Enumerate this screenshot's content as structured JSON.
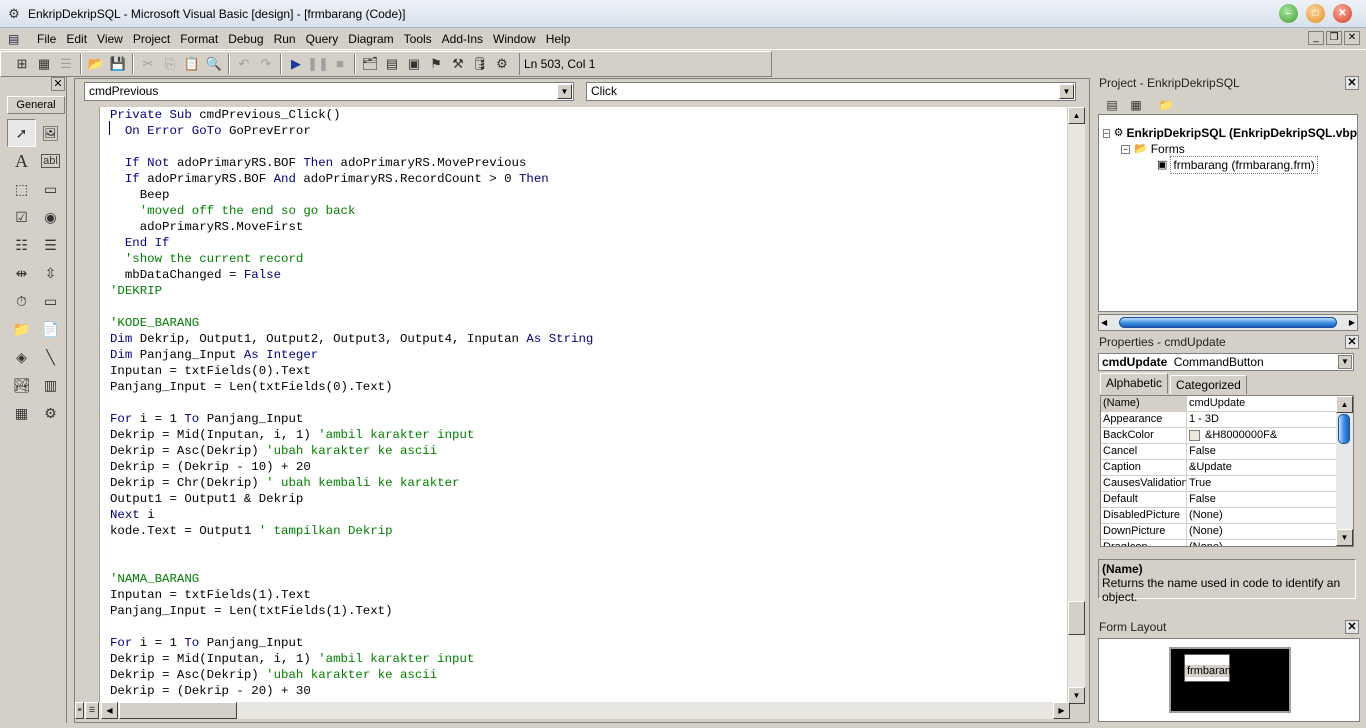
{
  "window": {
    "title": "EnkripDekripSQL - Microsoft Visual Basic [design] - [frmbarang (Code)]",
    "controls": {
      "minimize": "–",
      "maximize": "□",
      "close": "✕"
    }
  },
  "menu": [
    "File",
    "Edit",
    "View",
    "Project",
    "Format",
    "Debug",
    "Run",
    "Query",
    "Diagram",
    "Tools",
    "Add-Ins",
    "Window",
    "Help"
  ],
  "mdi_controls": {
    "minimize": "_",
    "restore": "❐",
    "close": "✕"
  },
  "toolbar": {
    "status": "Ln 503, Col 1",
    "icons": [
      "add-project-icon",
      "add-form-icon",
      "menu-editor-icon",
      "open-icon",
      "save-icon",
      "cut-icon",
      "copy-icon",
      "paste-icon",
      "find-icon",
      "undo-icon",
      "redo-icon",
      "run-icon",
      "break-icon",
      "stop-icon",
      "project-explorer-icon",
      "properties-window-icon",
      "form-layout-icon",
      "object-browser-icon",
      "toolbox-icon",
      "data-view-icon",
      "component-manager-icon"
    ]
  },
  "toolbox": {
    "tab": "General",
    "close": "✕",
    "tools": [
      "pointer",
      "picturebox",
      "label",
      "textbox",
      "frame",
      "commandbutton",
      "checkbox",
      "optionbutton",
      "combobox",
      "listbox",
      "hscrollbar",
      "vscrollbar",
      "timer",
      "drivelistbox",
      "dirlistbox",
      "filelistbox",
      "shape",
      "line",
      "image",
      "data",
      "ole",
      "adodc"
    ]
  },
  "code": {
    "object_combo": "cmdPrevious",
    "proc_combo": "Click",
    "lines": [
      [
        [
          "kw",
          "Private Sub "
        ],
        [
          "tx",
          "cmdPrevious_Click()"
        ]
      ],
      [
        [
          "tx",
          "  "
        ],
        [
          "kw",
          "On Error GoTo "
        ],
        [
          "tx",
          "GoPrevError"
        ]
      ],
      [],
      [
        [
          "tx",
          "  "
        ],
        [
          "kw",
          "If Not "
        ],
        [
          "tx",
          "adoPrimaryRS.BOF "
        ],
        [
          "kw",
          "Then "
        ],
        [
          "tx",
          "adoPrimaryRS.MovePrevious"
        ]
      ],
      [
        [
          "tx",
          "  "
        ],
        [
          "kw",
          "If "
        ],
        [
          "tx",
          "adoPrimaryRS.BOF "
        ],
        [
          "kw",
          "And "
        ],
        [
          "tx",
          "adoPrimaryRS.RecordCount > 0 "
        ],
        [
          "kw",
          "Then"
        ]
      ],
      [
        [
          "tx",
          "    Beep"
        ]
      ],
      [
        [
          "tx",
          "    "
        ],
        [
          "cm",
          "'moved off the end so go back"
        ]
      ],
      [
        [
          "tx",
          "    adoPrimaryRS.MoveFirst"
        ]
      ],
      [
        [
          "tx",
          "  "
        ],
        [
          "kw",
          "End If"
        ]
      ],
      [
        [
          "tx",
          "  "
        ],
        [
          "cm",
          "'show the current record"
        ]
      ],
      [
        [
          "tx",
          "  mbDataChanged = "
        ],
        [
          "kw",
          "False"
        ]
      ],
      [
        [
          "cm",
          "'DEKRIP"
        ]
      ],
      [],
      [
        [
          "cm",
          "'KODE_BARANG"
        ]
      ],
      [
        [
          "kw",
          "Dim "
        ],
        [
          "tx",
          "Dekrip, Output1, Output2, Output3, Output4, Inputan "
        ],
        [
          "kw",
          "As String"
        ]
      ],
      [
        [
          "kw",
          "Dim "
        ],
        [
          "tx",
          "Panjang_Input "
        ],
        [
          "kw",
          "As Integer"
        ]
      ],
      [
        [
          "tx",
          "Inputan = txtFields(0).Text"
        ]
      ],
      [
        [
          "tx",
          "Panjang_Input = Len(txtFields(0).Text)"
        ]
      ],
      [],
      [
        [
          "kw",
          "For "
        ],
        [
          "tx",
          "i = 1 "
        ],
        [
          "kw",
          "To "
        ],
        [
          "tx",
          "Panjang_Input"
        ]
      ],
      [
        [
          "tx",
          "Dekrip = Mid(Inputan, i, 1) "
        ],
        [
          "cm",
          "'ambil karakter input"
        ]
      ],
      [
        [
          "tx",
          "Dekrip = Asc(Dekrip) "
        ],
        [
          "cm",
          "'ubah karakter ke ascii"
        ]
      ],
      [
        [
          "tx",
          "Dekrip = (Dekrip - 10) + 20"
        ]
      ],
      [
        [
          "tx",
          "Dekrip = Chr(Dekrip) "
        ],
        [
          "cm",
          "' ubah kembali ke karakter"
        ]
      ],
      [
        [
          "tx",
          "Output1 = Output1 & Dekrip"
        ]
      ],
      [
        [
          "kw",
          "Next "
        ],
        [
          "tx",
          "i"
        ]
      ],
      [
        [
          "tx",
          "kode.Text = Output1 "
        ],
        [
          "cm",
          "' tampilkan Dekrip"
        ]
      ],
      [],
      [],
      [
        [
          "cm",
          "'NAMA_BARANG"
        ]
      ],
      [
        [
          "tx",
          "Inputan = txtFields(1).Text"
        ]
      ],
      [
        [
          "tx",
          "Panjang_Input = Len(txtFields(1).Text)"
        ]
      ],
      [],
      [
        [
          "kw",
          "For "
        ],
        [
          "tx",
          "i = 1 "
        ],
        [
          "kw",
          "To "
        ],
        [
          "tx",
          "Panjang_Input"
        ]
      ],
      [
        [
          "tx",
          "Dekrip = Mid(Inputan, i, 1) "
        ],
        [
          "cm",
          "'ambil karakter input"
        ]
      ],
      [
        [
          "tx",
          "Dekrip = Asc(Dekrip) "
        ],
        [
          "cm",
          "'ubah karakter ke ascii"
        ]
      ],
      [
        [
          "tx",
          "Dekrip = (Dekrip - 20) + 30"
        ]
      ]
    ]
  },
  "project": {
    "title": "Project - EnkripDekripSQL",
    "root": "EnkripDekripSQL (EnkripDekripSQL.vbp)",
    "folder": "Forms",
    "item": "frmbarang (frmbarang.frm)"
  },
  "properties": {
    "title": "Properties - cmdUpdate",
    "object_name": "cmdUpdate",
    "object_type": "CommandButton",
    "tabs": [
      "Alphabetic",
      "Categorized"
    ],
    "rows": [
      {
        "name": "(Name)",
        "value": "cmdUpdate"
      },
      {
        "name": "Appearance",
        "value": "1 - 3D"
      },
      {
        "name": "BackColor",
        "value": "&H8000000F&"
      },
      {
        "name": "Cancel",
        "value": "False"
      },
      {
        "name": "Caption",
        "value": "&Update"
      },
      {
        "name": "CausesValidation",
        "value": "True"
      },
      {
        "name": "Default",
        "value": "False"
      },
      {
        "name": "DisabledPicture",
        "value": "(None)"
      },
      {
        "name": "DownPicture",
        "value": "(None)"
      },
      {
        "name": "DragIcon",
        "value": "(None)"
      }
    ],
    "desc_title": "(Name)",
    "desc_text": "Returns the name used in code to identify an object."
  },
  "form_layout": {
    "title": "Form Layout",
    "form_label": "frmbarang"
  }
}
